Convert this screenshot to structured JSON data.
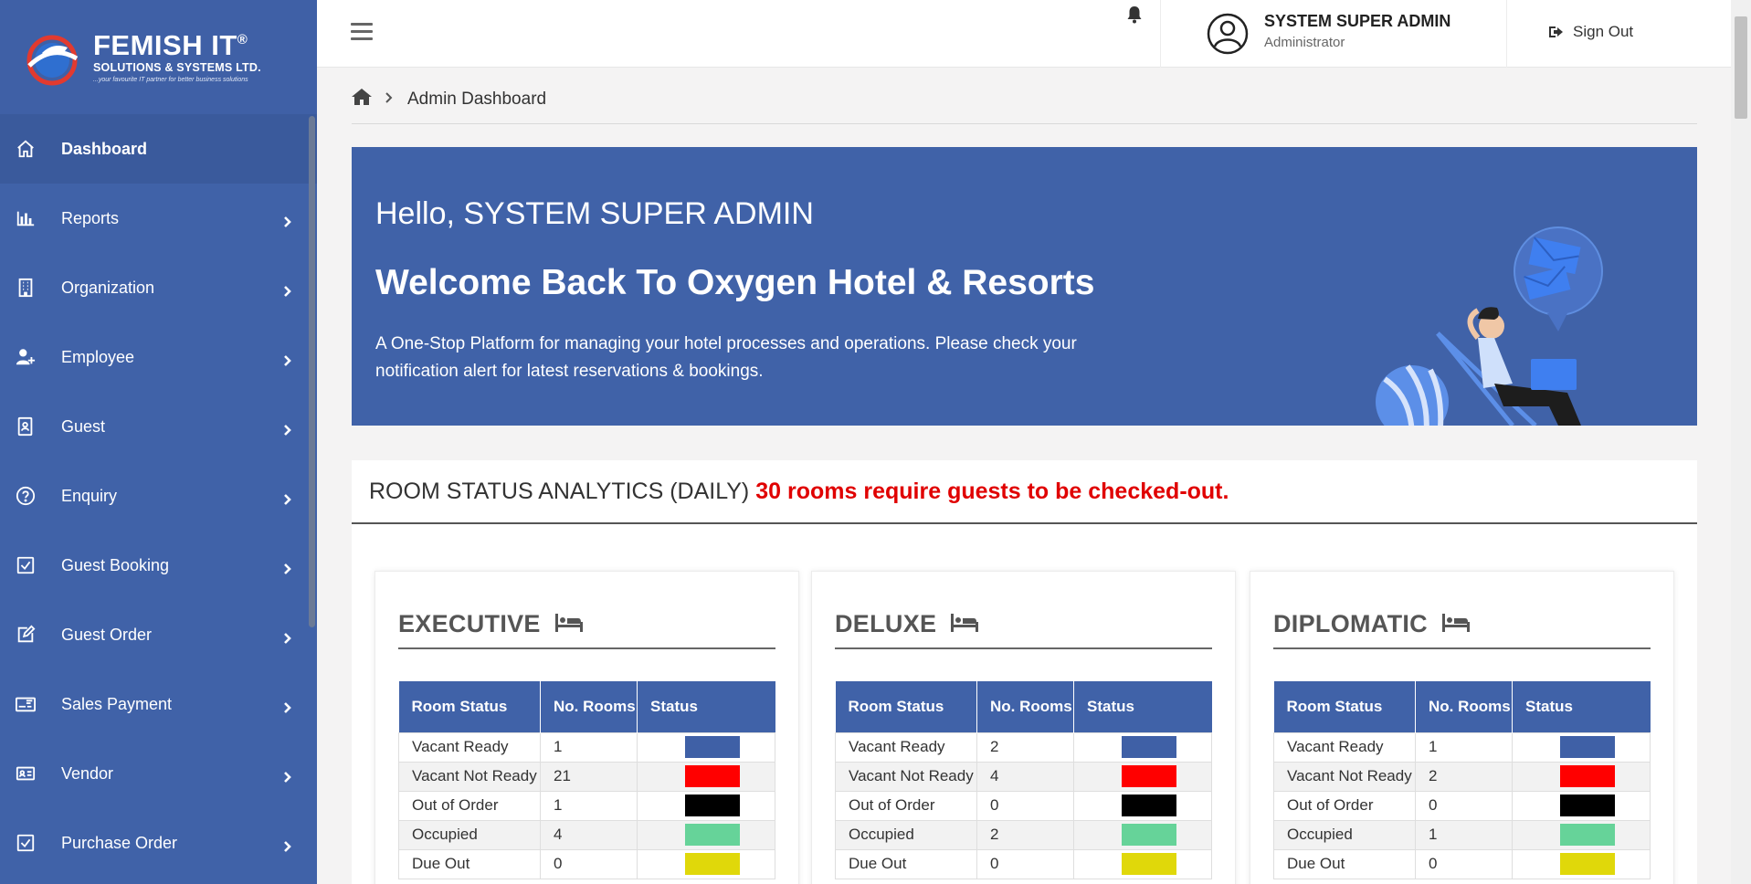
{
  "brand": {
    "name": "FEMISH IT",
    "reg": "®",
    "subtitle": "SOLUTIONS & SYSTEMS LTD.",
    "tagline": "...your favourite IT partner for better business solutions"
  },
  "sidebar": {
    "items": [
      {
        "label": "Dashboard",
        "icon": "home-icon"
      },
      {
        "label": "Reports",
        "icon": "bar-chart-icon"
      },
      {
        "label": "Organization",
        "icon": "building-icon"
      },
      {
        "label": "Employee",
        "icon": "user-plus-icon"
      },
      {
        "label": "Guest",
        "icon": "id-card-icon"
      },
      {
        "label": "Enquiry",
        "icon": "question-circle-icon"
      },
      {
        "label": "Guest Booking",
        "icon": "check-square-icon"
      },
      {
        "label": "Guest Order",
        "icon": "edit-icon"
      },
      {
        "label": "Sales Payment",
        "icon": "payment-card-icon"
      },
      {
        "label": "Vendor",
        "icon": "address-card-icon"
      },
      {
        "label": "Purchase Order",
        "icon": "check-square-icon"
      }
    ]
  },
  "header": {
    "user_name": "SYSTEM SUPER ADMIN",
    "user_role": "Administrator",
    "signout_label": "Sign Out"
  },
  "breadcrumb": {
    "current": "Admin Dashboard"
  },
  "banner": {
    "hello": "Hello, SYSTEM SUPER ADMIN",
    "welcome": "Welcome Back To Oxygen Hotel & Resorts",
    "description": "A One-Stop Platform for managing your hotel processes and operations. Please check your notification alert for latest reservations & bookings."
  },
  "analytics": {
    "title": "ROOM STATUS ANALYTICS (DAILY)",
    "alert": "30 rooms require guests to be checked-out.",
    "columns": [
      "Room Status",
      "No. Rooms",
      "Status"
    ],
    "status_colors": {
      "Vacant Ready": "#3f60a6",
      "Vacant Not Ready": "#ff0000",
      "Out of Order": "#000000",
      "Occupied": "#66d399",
      "Due Out": "#e0d80a"
    },
    "rooms": [
      {
        "name": "EXECUTIVE",
        "rows": [
          {
            "status": "Vacant Ready",
            "count": "1"
          },
          {
            "status": "Vacant Not Ready",
            "count": "21"
          },
          {
            "status": "Out of Order",
            "count": "1"
          },
          {
            "status": "Occupied",
            "count": "4"
          },
          {
            "status": "Due Out",
            "count": "0"
          }
        ]
      },
      {
        "name": "DELUXE",
        "rows": [
          {
            "status": "Vacant Ready",
            "count": "2"
          },
          {
            "status": "Vacant Not Ready",
            "count": "4"
          },
          {
            "status": "Out of Order",
            "count": "0"
          },
          {
            "status": "Occupied",
            "count": "2"
          },
          {
            "status": "Due Out",
            "count": "0"
          }
        ]
      },
      {
        "name": "DIPLOMATIC",
        "rows": [
          {
            "status": "Vacant Ready",
            "count": "1"
          },
          {
            "status": "Vacant Not Ready",
            "count": "2"
          },
          {
            "status": "Out of Order",
            "count": "0"
          },
          {
            "status": "Occupied",
            "count": "1"
          },
          {
            "status": "Due Out",
            "count": "0"
          }
        ]
      }
    ]
  }
}
